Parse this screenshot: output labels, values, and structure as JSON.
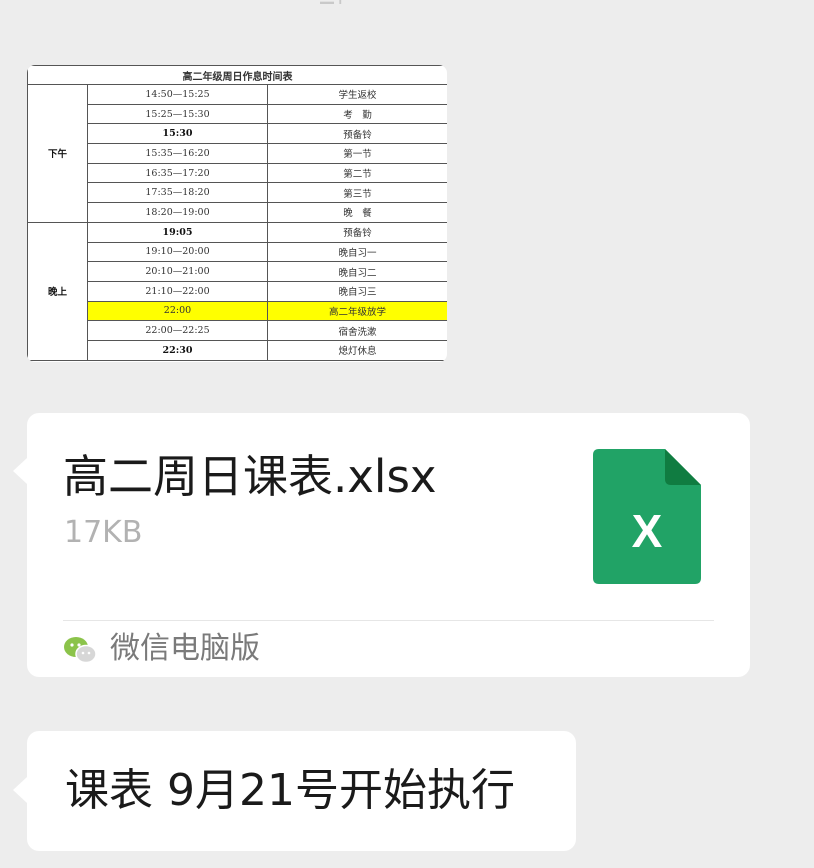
{
  "image_message": {
    "table": {
      "title": "高二年级周日作息时间表",
      "periods": [
        "下午",
        "晚上"
      ],
      "rows": [
        {
          "time": "14:50—15:25",
          "activity": "学生返校"
        },
        {
          "time": "15:25—15:30",
          "activity": "考　勤"
        },
        {
          "time": "15:30",
          "activity": "预备铃"
        },
        {
          "time": "15:35—16:20",
          "activity": "第一节"
        },
        {
          "time": "16:35—17:20",
          "activity": "第二节"
        },
        {
          "time": "17:35—18:20",
          "activity": "第三节"
        },
        {
          "time": "18:20—19:00",
          "activity": "晚　餐"
        },
        {
          "time": "19:05",
          "activity": "预备铃"
        },
        {
          "time": "19:10—20:00",
          "activity": "晚自习一"
        },
        {
          "time": "20:10—21:00",
          "activity": "晚自习二"
        },
        {
          "time": "21:10—22:00",
          "activity": "晚自习三"
        },
        {
          "time": "22:00",
          "activity": "高二年级放学"
        },
        {
          "time": "22:00—22:25",
          "activity": "宿舍洗漱"
        },
        {
          "time": "22:30",
          "activity": "熄灯休息"
        }
      ],
      "highlight_color": "#ffff00"
    }
  },
  "file_message": {
    "file_name": "高二周日课表.xlsx",
    "file_size": "17KB",
    "icon": "excel-file-icon",
    "icon_letter": "X",
    "icon_color": "#21a366",
    "source_icon": "wechat-icon",
    "source_label": "微信电脑版"
  },
  "text_message": {
    "text": "课表 9月21号开始执行"
  },
  "colors": {
    "background": "#ededed",
    "bubble": "#ffffff"
  }
}
